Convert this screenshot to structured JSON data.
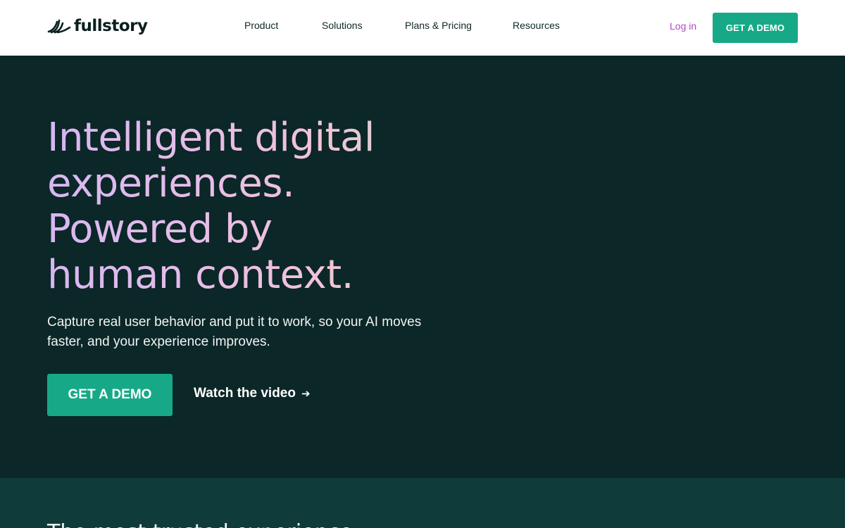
{
  "header": {
    "logo_text": "fullstory",
    "nav": [
      "Product",
      "Solutions",
      "Plans & Pricing",
      "Resources"
    ],
    "login_label": "Log in",
    "demo_label": "GET A DEMO"
  },
  "hero": {
    "headline_lines": [
      "Intelligent digital",
      "experiences.",
      "Powered by",
      "human context."
    ],
    "subtext": "Capture real user behavior and put it to work, so your AI moves faster, and your experience improves.",
    "demo_label": "GET A DEMO",
    "watch_label": "Watch the video",
    "watch_icon": "arrow-right-icon"
  },
  "band": {
    "partial_heading": "The most trusted experience"
  },
  "colors": {
    "accent": "#17a987",
    "hero_bg": "#0b2727",
    "band_bg": "#0f3b3b",
    "login": "#b145c9"
  }
}
